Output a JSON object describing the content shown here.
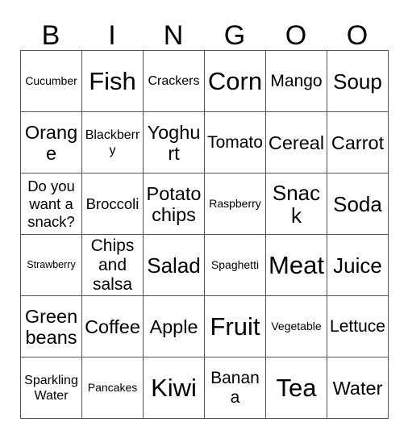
{
  "card": {
    "title_letters": [
      "B",
      "I",
      "N",
      "G",
      "O",
      "O"
    ],
    "columns": 6,
    "rows": 6,
    "colors": {
      "background": "#ffffff",
      "grid_line": "#555555",
      "text": "#000000"
    },
    "cells": [
      [
        {
          "label": "Cucumber",
          "size": "fs-sm"
        },
        {
          "label": "Fish",
          "size": "fs-4xl"
        },
        {
          "label": "Crackers",
          "size": "fs-md"
        },
        {
          "label": "Corn",
          "size": "fs-4xl"
        },
        {
          "label": "Mango",
          "size": "fs-xl"
        },
        {
          "label": "Soup",
          "size": "fs-3xl"
        }
      ],
      [
        {
          "label": "Orange",
          "size": "fs-2xl"
        },
        {
          "label": "Blackberry",
          "size": "fs-md"
        },
        {
          "label": "Yoghurt",
          "size": "fs-2xl"
        },
        {
          "label": "Tomato",
          "size": "fs-xl"
        },
        {
          "label": "Cereal",
          "size": "fs-2xl"
        },
        {
          "label": "Carrot",
          "size": "fs-2xl"
        }
      ],
      [
        {
          "label": "Do you want a snack?",
          "size": "fs-lg"
        },
        {
          "label": "Broccoli",
          "size": "fs-lg"
        },
        {
          "label": "Potato chips",
          "size": "fs-2xl"
        },
        {
          "label": "Raspberry",
          "size": "fs-sm"
        },
        {
          "label": "Snack",
          "size": "fs-3xl"
        },
        {
          "label": "Soda",
          "size": "fs-3xl"
        }
      ],
      [
        {
          "label": "Strawberry",
          "size": "fs-xs"
        },
        {
          "label": "Chips and salsa",
          "size": "fs-xl"
        },
        {
          "label": "Salad",
          "size": "fs-3xl"
        },
        {
          "label": "Spaghetti",
          "size": "fs-sm"
        },
        {
          "label": "Meat",
          "size": "fs-4xl"
        },
        {
          "label": "Juice",
          "size": "fs-3xl"
        }
      ],
      [
        {
          "label": "Green beans",
          "size": "fs-2xl"
        },
        {
          "label": "Coffee",
          "size": "fs-2xl"
        },
        {
          "label": "Apple",
          "size": "fs-2xl"
        },
        {
          "label": "Fruit",
          "size": "fs-4xl"
        },
        {
          "label": "Vegetable",
          "size": "fs-sm"
        },
        {
          "label": "Lettuce",
          "size": "fs-xl"
        }
      ],
      [
        {
          "label": "Sparkling Water",
          "size": "fs-md"
        },
        {
          "label": "Pancakes",
          "size": "fs-sm"
        },
        {
          "label": "Kiwi",
          "size": "fs-4xl"
        },
        {
          "label": "Banana",
          "size": "fs-xl"
        },
        {
          "label": "Tea",
          "size": "fs-4xl"
        },
        {
          "label": "Water",
          "size": "fs-2xl"
        }
      ]
    ]
  }
}
